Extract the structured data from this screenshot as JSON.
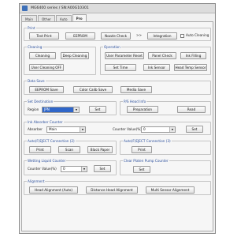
{
  "window": {
    "title": "MG6400 series / SN:A00G10301"
  },
  "tabs": [
    "Main",
    "Other",
    "Auto",
    "Pro"
  ],
  "print": {
    "label": "Print",
    "test_print": "Test Print",
    "eeprom": "EEPROM",
    "nozzle_check": "Nozzle Check",
    "arrow": ">>",
    "integration": "Integration",
    "auto_cleaning": "Auto Cleaning"
  },
  "cleaning": {
    "label": "Cleaning",
    "cleaning": "Cleaning",
    "deep_cleaning": "Deep Cleaning",
    "user_cleaning_off": "User Cleaning OFF"
  },
  "operation": {
    "label": "Operation",
    "user_param_reset": "User Parameter Reset",
    "panel_check": "Panel Check",
    "ink_filling": "Ink Filling",
    "set_time": "Set Time",
    "ink_sensor": "Ink Sensor",
    "head_temp_sensor": "Head Temp Sensor"
  },
  "data_save": {
    "label": "Data Save",
    "eeprom_save": "EEPROM Save",
    "color_calib_save": "Color Calib Save",
    "media_save": "Media Save"
  },
  "set_destination": {
    "label": "Set Destination",
    "region_label": "Region",
    "region_value": "JPN",
    "set": "Set"
  },
  "p_head_info": {
    "label": "P/S Head Info",
    "preparation": "Preparation",
    "read": "Read"
  },
  "ink_absorber": {
    "label": "Ink Absorber Counter",
    "absorber_label": "Absorber",
    "absorber_value": "Main",
    "counter_label": "Counter Value(%)",
    "counter_value": "0",
    "set": "Set"
  },
  "auto_ejector_2": {
    "label": "Auto(F)EJECT Connection (2)",
    "print": "Print",
    "scan": "Scan",
    "black_paper": "Black Paper"
  },
  "auto_ejector_3": {
    "label": "Auto(F)EJECT Connection (3)",
    "print": "Print"
  },
  "wetting": {
    "label": "Wetting Liquid Counter",
    "counter_label": "Counter Value(%)",
    "counter_value": "0",
    "set": "Set"
  },
  "platen": {
    "label": "Clear Platen Pump Counter",
    "set": "Set"
  },
  "alignment": {
    "label": "Alignment",
    "head_auto": "Head Alignment (Auto)",
    "distance_head": "Distance Head Alignment",
    "multi_sensor": "Multi Sensor Alignment"
  },
  "watermark": "ORBIS"
}
